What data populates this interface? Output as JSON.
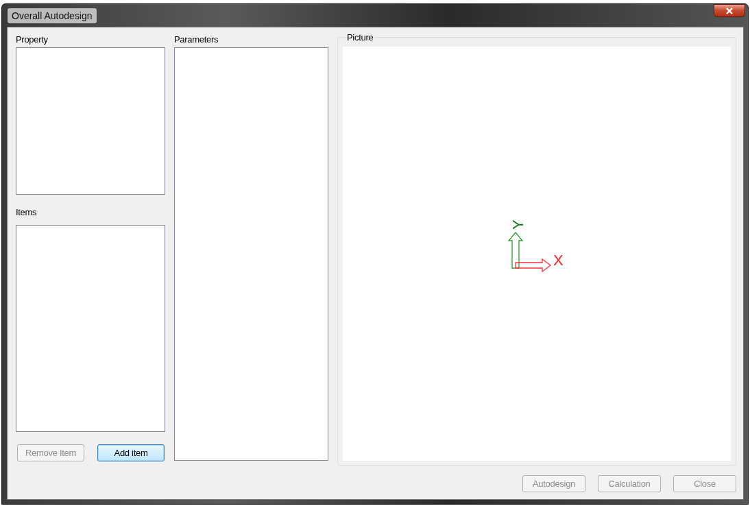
{
  "window": {
    "title": "Overall Autodesign"
  },
  "property": {
    "label": "Property"
  },
  "items": {
    "label": "Items"
  },
  "item_buttons": [
    {
      "label": "Remove Item",
      "disabled": true,
      "focused": false
    },
    {
      "label": "Add item",
      "disabled": false,
      "focused": true
    }
  ],
  "parameters": {
    "label": "Parameters"
  },
  "picture": {
    "label": "Picture",
    "axis_x": "X",
    "axis_y": "Y"
  },
  "footer_buttons": [
    {
      "label": "Autodesign",
      "disabled": true
    },
    {
      "label": "Calculation",
      "disabled": true
    },
    {
      "label": "Close",
      "disabled": true
    }
  ]
}
